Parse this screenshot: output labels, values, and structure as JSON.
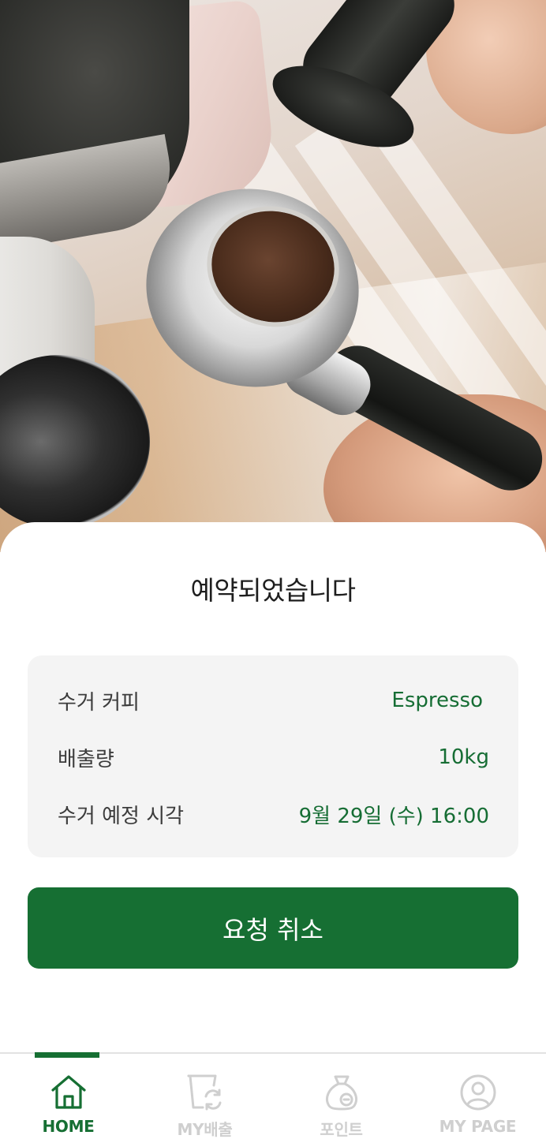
{
  "sheet": {
    "title": "예약되었습니다"
  },
  "details": [
    {
      "label": "수거 커피",
      "value": "Espresso"
    },
    {
      "label": "배출량",
      "value": "10kg"
    },
    {
      "label": "수거 예정 시각",
      "value": "9월 29일 (수) 16:00"
    }
  ],
  "actions": {
    "cancel_label": "요청 취소"
  },
  "bottom_nav": {
    "items": [
      {
        "label": "HOME",
        "icon": "home-icon",
        "active": true
      },
      {
        "label": "MY배출",
        "icon": "disposal-bin-icon",
        "active": false
      },
      {
        "label": "포인트",
        "icon": "point-bag-icon",
        "active": false
      },
      {
        "label": "MY PAGE",
        "icon": "profile-icon",
        "active": false
      }
    ]
  },
  "colors": {
    "accent": "#166f33",
    "value_text": "#166d34",
    "card_bg": "#f4f4f4",
    "inactive_nav": "#cfcfcf"
  }
}
